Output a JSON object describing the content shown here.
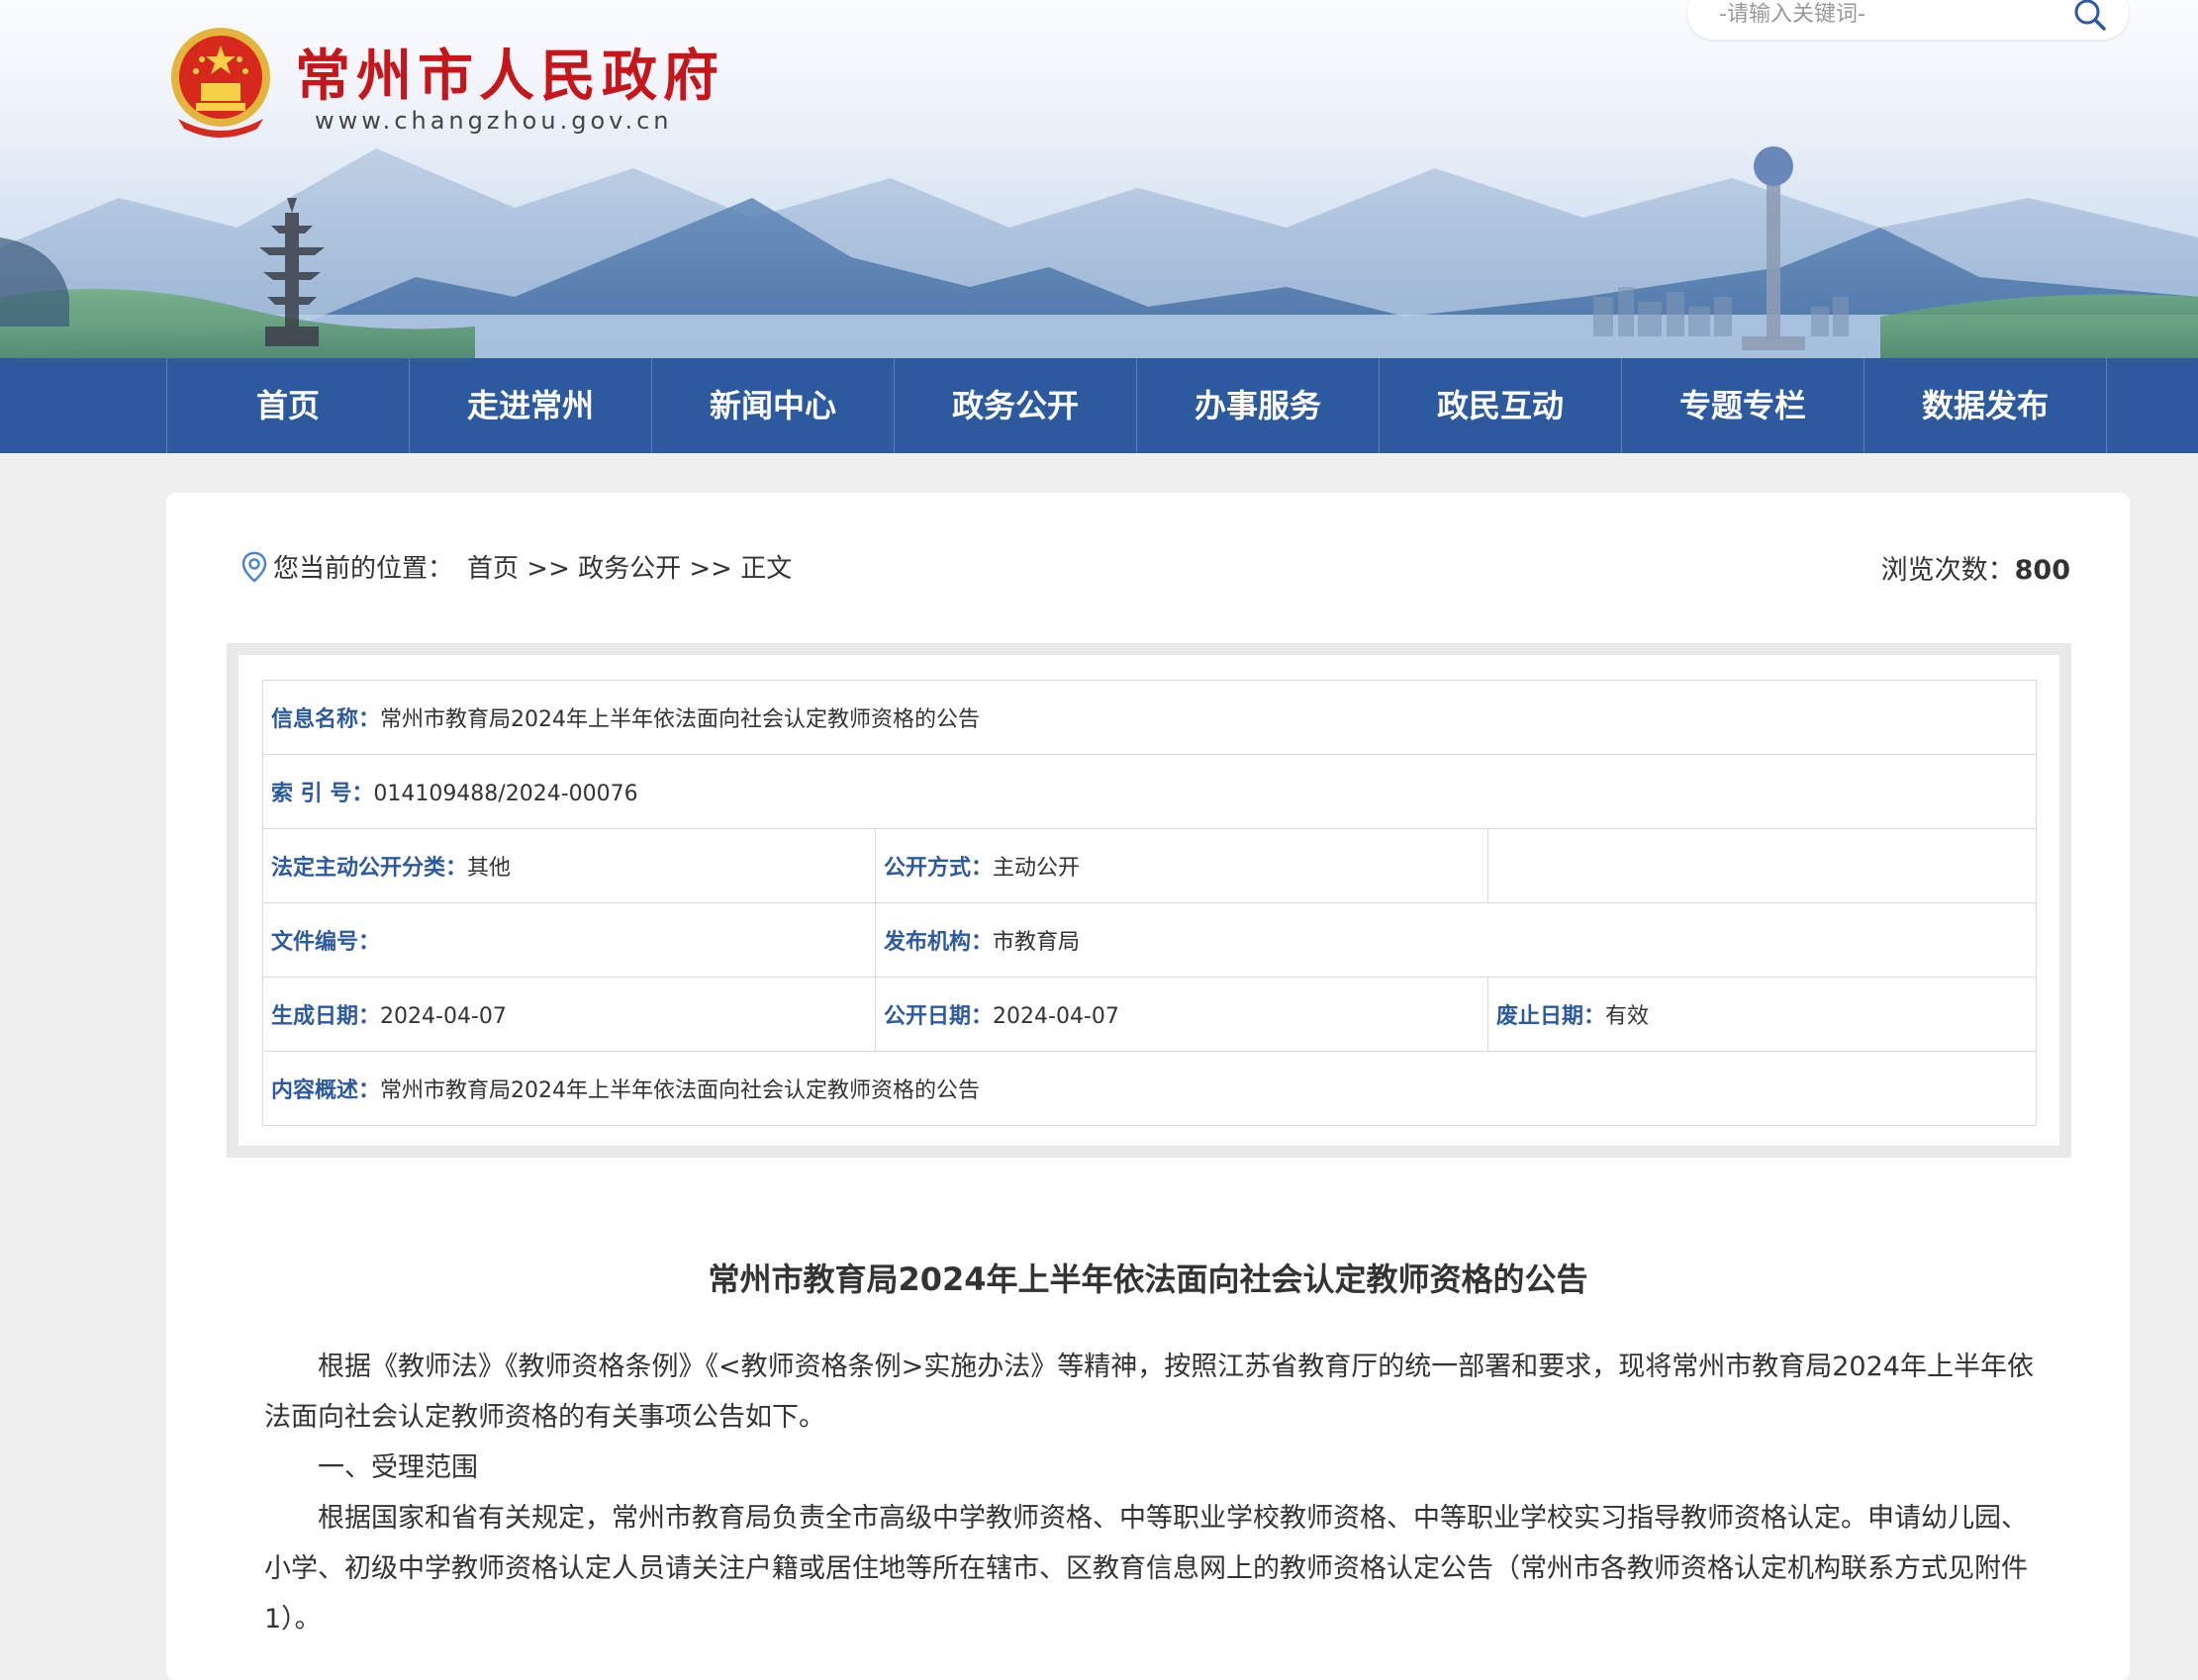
{
  "header": {
    "site_title": "常州市人民政府",
    "site_url": "www.changzhou.gov.cn",
    "search_placeholder": "-请输入关键词-",
    "logo_icon": "national-emblem-icon",
    "search_icon": "magnifier-icon"
  },
  "nav": {
    "items": [
      "首页",
      "走进常州",
      "新闻中心",
      "政务公开",
      "办事服务",
      "政民互动",
      "专题专栏",
      "数据发布"
    ]
  },
  "breadcrumb": {
    "label": "您当前的位置：",
    "path": "首页 >> 政务公开 >> 正文"
  },
  "views": {
    "label": "浏览次数：",
    "count": "800"
  },
  "meta": {
    "info_name_label": "信息名称：",
    "info_name": "常州市教育局2024年上半年依法面向社会认定教师资格的公告",
    "index_label": "索 引 号：",
    "index": "014109488/2024-00076",
    "category_label": "法定主动公开分类：",
    "category": "其他",
    "method_label": "公开方式：",
    "method": "主动公开",
    "doc_no_label": "文件编号：",
    "doc_no": "",
    "publisher_label": "发布机构：",
    "publisher": "市教育局",
    "created_label": "生成日期：",
    "created": "2024-04-07",
    "published_label": "公开日期：",
    "published": "2024-04-07",
    "expiry_label": "废止日期：",
    "expiry": "有效",
    "summary_label": "内容概述：",
    "summary": "常州市教育局2024年上半年依法面向社会认定教师资格的公告"
  },
  "article": {
    "title": "常州市教育局2024年上半年依法面向社会认定教师资格的公告",
    "paragraphs": [
      "根据《教师法》《教师资格条例》《<教师资格条例>实施办法》等精神，按照江苏省教育厅的统一部署和要求，现将常州市教育局2024年上半年依法面向社会认定教师资格的有关事项公告如下。",
      "一、受理范围",
      "根据国家和省有关规定，常州市教育局负责全市高级中学教师资格、中等职业学校教师资格、中等职业学校实习指导教师资格认定。申请幼儿园、小学、初级中学教师资格认定人员请关注户籍或居住地等所在辖市、区教育信息网上的教师资格认定公告（常州市各教师资格认定机构联系方式见附件1）。"
    ]
  },
  "colors": {
    "brand_red": "#c6161c",
    "nav_blue": "#2d5a9e",
    "label_blue": "#2d5a9e"
  }
}
